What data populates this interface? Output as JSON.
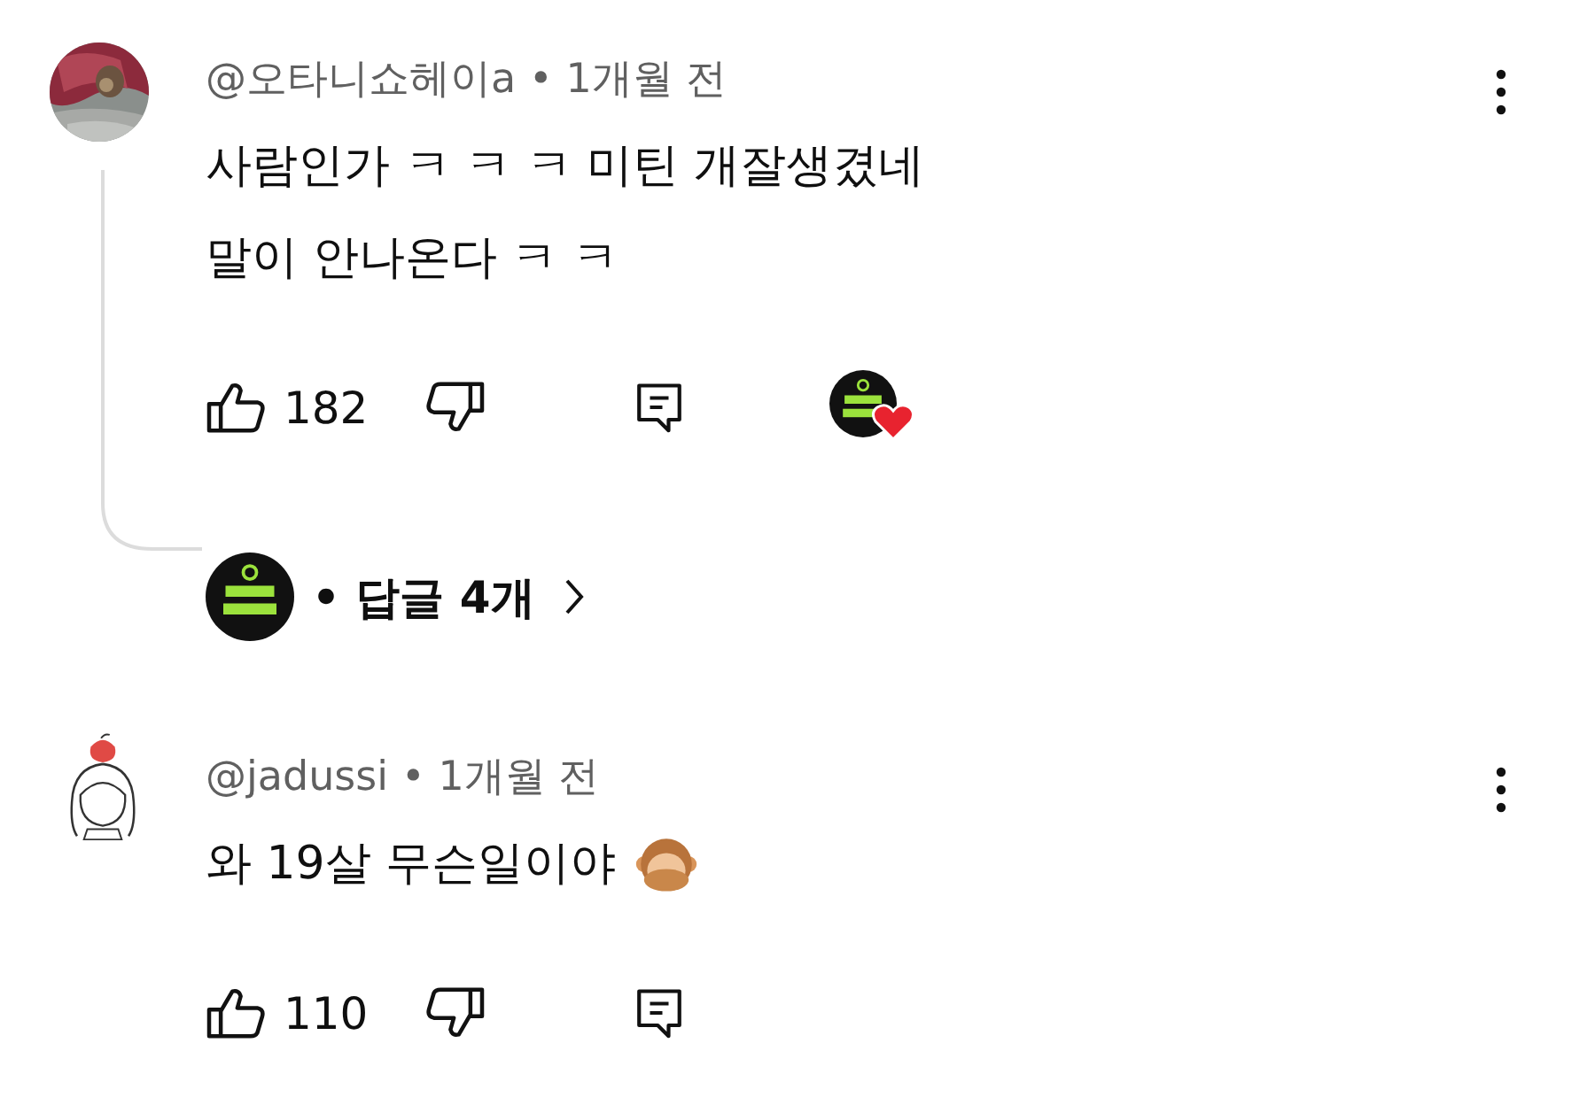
{
  "comments": [
    {
      "header": "@오타니쇼헤이a • 1개월 전",
      "lines": [
        "사람인가 ㅋ ㅋ ㅋ 미틴 개잘생겼네",
        "말이 안나온다 ㅋ ㅋ"
      ],
      "emoji_icon": false,
      "likes": "182",
      "creator_heart": true,
      "replies": "• 답글 4개"
    },
    {
      "kind": "drawing",
      "header": "@jadussi • 1개월 전",
      "lines": [
        "와 19살 무슨일이야"
      ],
      "emoji_icon": true,
      "likes": "110",
      "creator_heart": false
    }
  ]
}
